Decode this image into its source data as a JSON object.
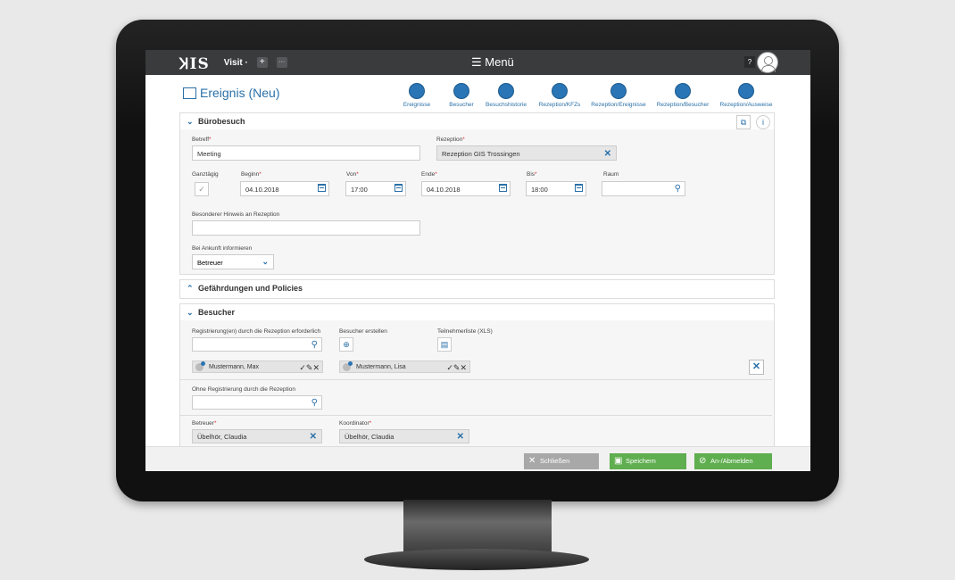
{
  "topbar": {
    "logo": "ꞰIS",
    "visit": "Visit ·",
    "plus": "+",
    "more": "···",
    "menu": "☰ Menü",
    "help": "?"
  },
  "header": {
    "title": "Ereignis (Neu)"
  },
  "nav": [
    {
      "label": "Ereignisse",
      "icon": "events-icon"
    },
    {
      "label": "Besucher",
      "icon": "visitor-icon"
    },
    {
      "label": "Besuchshistorie",
      "icon": "history-icon"
    },
    {
      "label": "Rezeption/KFZs",
      "icon": "car-icon"
    },
    {
      "label": "Rezeption/Ereignisse",
      "icon": "reception-events-icon"
    },
    {
      "label": "Rezeption/Besucher",
      "icon": "reception-visitor-icon"
    },
    {
      "label": "Rezeption/Ausweise",
      "icon": "badge-icon"
    }
  ],
  "buero": {
    "title": "Bürobesuch",
    "betreff_label": "Betreff",
    "betreff_value": "Meeting",
    "rezeption_label": "Rezeption",
    "rezeption_value": "Rezeption GIS Trossingen",
    "ganztaegig_label": "Ganztägig",
    "beginn_label": "Beginn",
    "beginn_value": "04.10.2018",
    "von_label": "Von",
    "von_value": "17:00",
    "ende_label": "Ende",
    "ende_value": "04.10.2018",
    "bis_label": "Bis",
    "bis_value": "18:00",
    "raum_label": "Raum",
    "hinweis_label": "Besonderer Hinweis an Rezeption",
    "ankunft_label": "Bei Ankunft informieren",
    "ankunft_value": "Betreuer"
  },
  "gefaehrdungen": {
    "title": "Gefährdungen und Policies"
  },
  "besucher": {
    "title": "Besucher",
    "reg_label": "Registrierung(en) durch die Rezeption erforderlich",
    "erstellen_label": "Besucher erstellen",
    "teilnehmer_label": "Teilnehmerliste (XLS)",
    "chips": [
      "Mustermann, Max",
      "Mustermann, Lisa"
    ],
    "ohne_label": "Ohne Registrierung durch die Rezeption",
    "betreuer_label": "Betreuer",
    "betreuer_value": "Übelhör, Claudia",
    "koordinator_label": "Koordinator",
    "koordinator_value": "Übelhör, Claudia"
  },
  "footer": {
    "close": "Schließen",
    "save": "Speichern",
    "register": "An-/Abmelden"
  },
  "colors": {
    "accent": "#2a70a8",
    "save": "#5fae4f",
    "close": "#a8a8a8",
    "topbar": "#3a3b3d"
  }
}
